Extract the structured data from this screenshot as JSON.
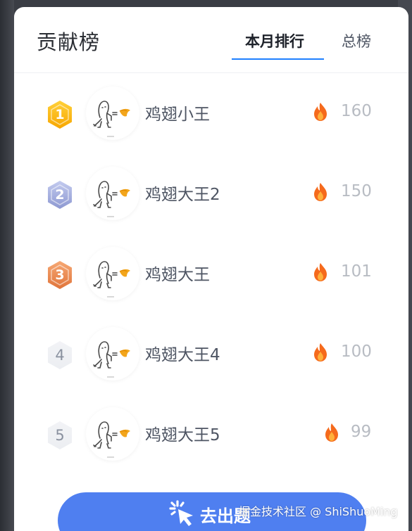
{
  "header": {
    "title": "贡献榜",
    "tabs": [
      {
        "label": "本月排行",
        "active": true
      },
      {
        "label": "总榜",
        "active": false
      }
    ]
  },
  "ranking": [
    {
      "rank": "1",
      "badge": "gold",
      "name": "鸡翅小王",
      "score": "160"
    },
    {
      "rank": "2",
      "badge": "silver",
      "name": "鸡翅大王2",
      "score": "150"
    },
    {
      "rank": "3",
      "badge": "bronze",
      "name": "鸡翅大王",
      "score": "101"
    },
    {
      "rank": "4",
      "badge": "plain",
      "name": "鸡翅大王4",
      "score": "100"
    },
    {
      "rank": "5",
      "badge": "plain",
      "name": "鸡翅大王5",
      "score": "99"
    }
  ],
  "cta": {
    "label": "去出题",
    "icon": "click-sparkle-icon"
  },
  "watermark": "掘金技术社区 @ ShiShuoMing",
  "colors": {
    "accent": "#1e80ff",
    "cta": "#4f7ff0",
    "gold": "#f7b500",
    "silver": "#9aa5d8",
    "bronze": "#e8844a",
    "fire": "#f56a1c"
  },
  "icons": {
    "avatar": "stick-figure-chicken-wing-avatar",
    "score": "fire-icon"
  }
}
